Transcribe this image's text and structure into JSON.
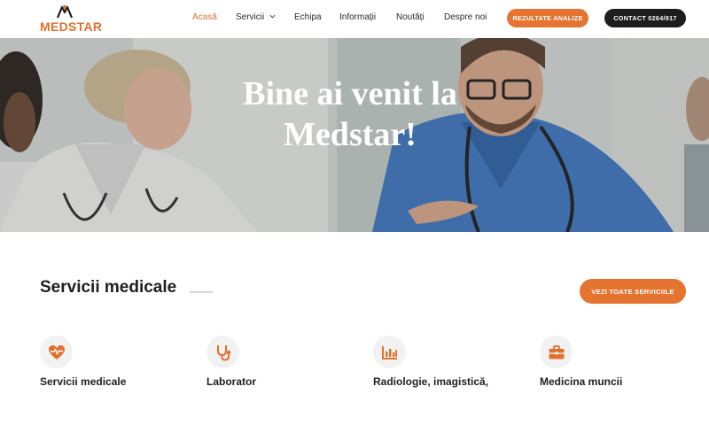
{
  "brand": {
    "name": "MEDSTAR",
    "accent": "#e2702d",
    "dark": "#1d1d1d"
  },
  "nav": {
    "items": [
      {
        "label": "Acasă",
        "active": true
      },
      {
        "label": "Servicii",
        "has_dropdown": true
      },
      {
        "label": "Echipa"
      },
      {
        "label": "Informații"
      },
      {
        "label": "Noutăți"
      },
      {
        "label": "Despre noi"
      }
    ],
    "results_button": "REZULTATE ANALIZE",
    "contact_button": "CONTACT 0264/917"
  },
  "hero": {
    "line1": "Bine ai venit la",
    "line2": "Medstar!"
  },
  "services": {
    "title": "Servicii medicale",
    "all_button": "VEZI TOATE SERVICIILE",
    "cards": [
      {
        "label": "Servicii medicale",
        "icon": "heart-pulse-icon"
      },
      {
        "label": "Laborator",
        "icon": "stethoscope-icon"
      },
      {
        "label": "Radiologie, imagistică,",
        "icon": "chart-bars-icon"
      },
      {
        "label": "Medicina muncii",
        "icon": "briefcase-icon"
      }
    ]
  }
}
